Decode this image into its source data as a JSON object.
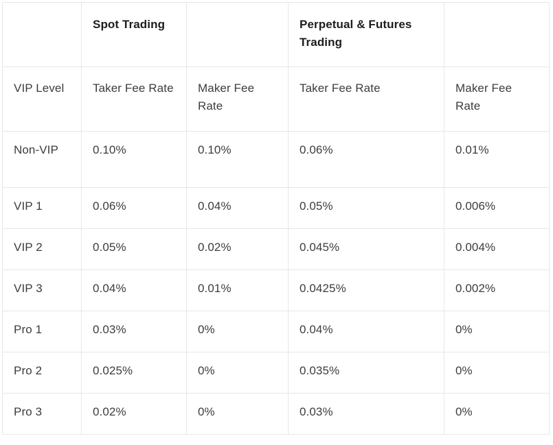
{
  "table": {
    "group_header": {
      "col1": "",
      "spot": "Spot Trading",
      "spot_spacer": "",
      "perpetual": "Perpetual & Futures Trading",
      "perpetual_spacer": ""
    },
    "column_headers": [
      "VIP Level",
      "Taker Fee Rate",
      "Maker Fee Rate",
      "Taker Fee Rate",
      "Maker Fee Rate"
    ],
    "rows": [
      {
        "vip_level": "Non-VIP",
        "spot_taker": "0.10%",
        "spot_maker": "0.10%",
        "perp_taker": "0.06%",
        "perp_maker": "0.01%"
      },
      {
        "vip_level": "VIP 1",
        "spot_taker": "0.06%",
        "spot_maker": "0.04%",
        "perp_taker": "0.05%",
        "perp_maker": "0.006%"
      },
      {
        "vip_level": "VIP 2",
        "spot_taker": "0.05%",
        "spot_maker": "0.02%",
        "perp_taker": "0.045%",
        "perp_maker": "0.004%"
      },
      {
        "vip_level": "VIP 3",
        "spot_taker": "0.04%",
        "spot_maker": "0.01%",
        "perp_taker": "0.0425%",
        "perp_maker": "0.002%"
      },
      {
        "vip_level": "Pro 1",
        "spot_taker": "0.03%",
        "spot_maker": "0%",
        "perp_taker": "0.04%",
        "perp_maker": "0%"
      },
      {
        "vip_level": "Pro 2",
        "spot_taker": "0.025%",
        "spot_maker": "0%",
        "perp_taker": "0.035%",
        "perp_maker": "0%"
      },
      {
        "vip_level": "Pro 3",
        "spot_taker": "0.02%",
        "spot_maker": "0%",
        "perp_taker": "0.03%",
        "perp_maker": "0%"
      }
    ],
    "colors": {
      "border": "#e6e6e6",
      "header_text": "#1d1d1f",
      "body_text": "#3c3c3c",
      "background": "#ffffff"
    }
  }
}
